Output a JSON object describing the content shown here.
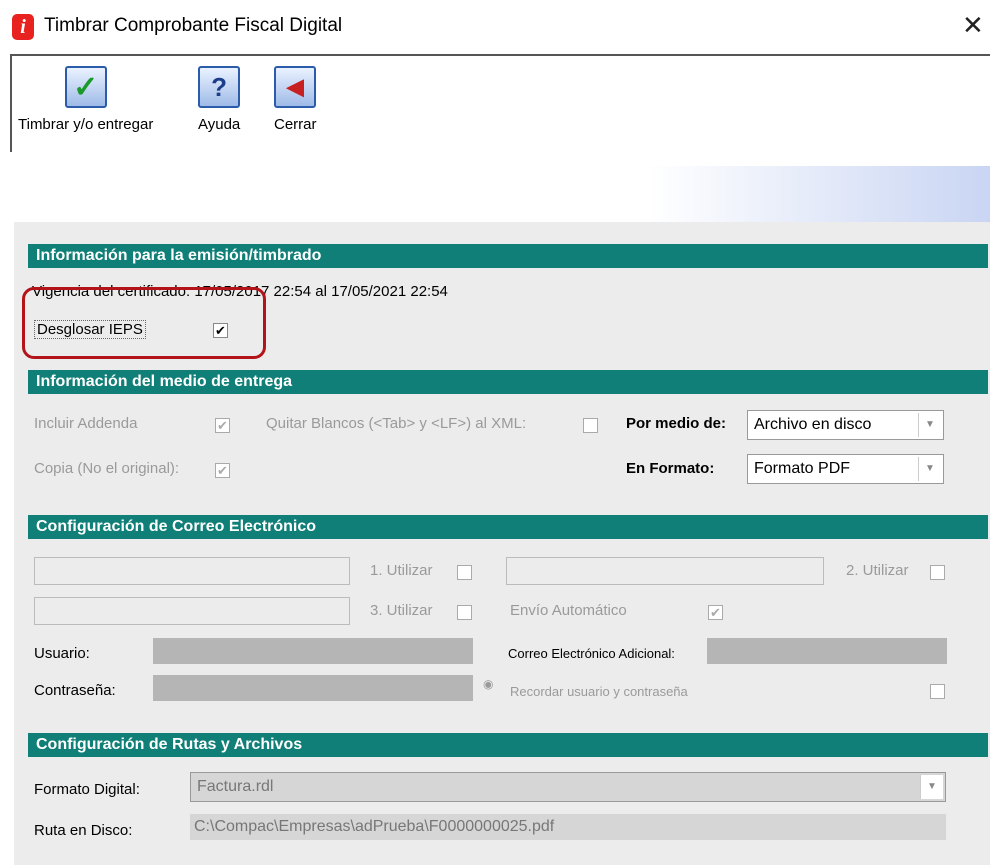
{
  "window": {
    "title": "Timbrar Comprobante Fiscal Digital",
    "app_icon_letter": "i"
  },
  "toolbar": {
    "timbrar_label": "Timbrar y/o entregar",
    "ayuda_label": "Ayuda",
    "cerrar_label": "Cerrar",
    "timbrar_icon": "checkmark-icon",
    "ayuda_icon": "help-icon",
    "cerrar_icon": "exit-door-icon"
  },
  "emision": {
    "header": "Información para la emisión/timbrado",
    "vigencia": "Vigencia del certificado: 17/05/2017 22:54 al 17/05/2021 22:54",
    "desglosar_label": "Desglosar IEPS",
    "desglosar_checked": true
  },
  "entrega": {
    "header": "Información del medio de entrega",
    "incluir_addenda": "Incluir Addenda",
    "quitar_blancos": "Quitar Blancos (<Tab> y <LF>) al  XML:",
    "copia": "Copia (No el original):",
    "por_medio_label": "Por medio de:",
    "por_medio_value": "Archivo en disco",
    "en_formato_label": "En Formato:",
    "en_formato_value": "Formato PDF"
  },
  "correo": {
    "header": "Configuración de Correo Electrónico",
    "utilizar1": "1. Utilizar",
    "utilizar2": "2. Utilizar",
    "utilizar3": "3. Utilizar",
    "envio_automatico": "Envío Automático",
    "usuario_label": "Usuario:",
    "correo_adicional_label": "Correo Electrónico Adicional:",
    "contrasena_label": "Contraseña:",
    "recordar_label": "Recordar usuario y contraseña"
  },
  "rutas": {
    "header": "Configuración de Rutas y Archivos",
    "formato_digital_label": "Formato Digital:",
    "formato_digital_value": "Factura.rdl",
    "ruta_label": "Ruta en Disco:",
    "ruta_value": "C:\\Compac\\Empresas\\adPrueba\\F0000000025.pdf"
  },
  "colors": {
    "section_bg": "#0f7f77",
    "highlight": "#b3141a",
    "app_icon": "#e8231f"
  }
}
